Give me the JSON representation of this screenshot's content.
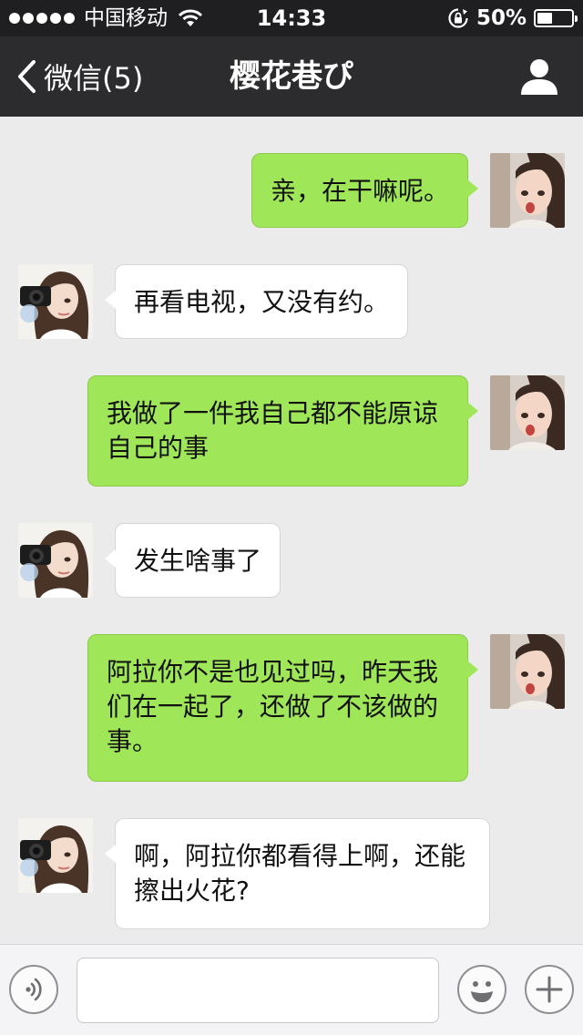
{
  "status_bar": {
    "carrier": "中国移动",
    "time": "14:33",
    "battery_percent": "50%",
    "battery_level": 0.5,
    "icons": [
      "signal-dots-icon",
      "wifi-icon",
      "rotation-lock-icon",
      "battery-icon"
    ]
  },
  "nav": {
    "back_label": "微信(5)",
    "title": "樱花巷ぴ",
    "icons": [
      "back-chevron-icon",
      "profile-icon"
    ]
  },
  "messages": [
    {
      "side": "out",
      "text": "亲，在干嘛呢。"
    },
    {
      "side": "in",
      "text": "再看电视，又没有约。"
    },
    {
      "side": "out",
      "text": "我做了一件我自己都不能原谅自己的事"
    },
    {
      "side": "in",
      "text": "发生啥事了"
    },
    {
      "side": "out",
      "text": "阿拉你不是也见过吗，昨天我们在一起了，还做了不该做的事。"
    },
    {
      "side": "in",
      "text": "啊，阿拉你都看得上啊，还能擦出火花?"
    }
  ],
  "input_bar": {
    "input_value": "",
    "icons": [
      "voice-icon",
      "emoji-icon",
      "plus-icon"
    ]
  },
  "colors": {
    "outgoing_bubble": "#9fe658",
    "incoming_bubble": "#ffffff",
    "chat_background": "#ebebeb",
    "nav_background": "#2c2c2e"
  }
}
